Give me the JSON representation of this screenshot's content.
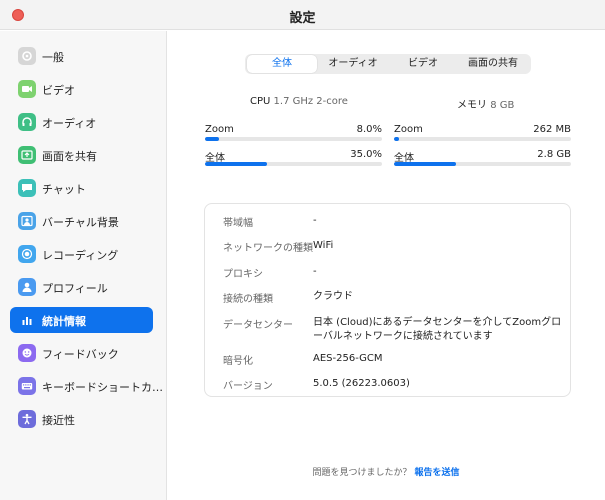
{
  "window": {
    "title": "設定"
  },
  "sidebar": {
    "items": [
      {
        "label": "一般",
        "icon": "gear-icon",
        "color": "#d6d6d6"
      },
      {
        "label": "ビデオ",
        "icon": "video-icon",
        "color": "#7ed26f"
      },
      {
        "label": "オーディオ",
        "icon": "headphones-icon",
        "color": "#3fbf86"
      },
      {
        "label": "画面を共有",
        "icon": "share-screen-icon",
        "color": "#3fbf74"
      },
      {
        "label": "チャット",
        "icon": "chat-icon",
        "color": "#3cc0b8"
      },
      {
        "label": "バーチャル背景",
        "icon": "virtual-background-icon",
        "color": "#4aa3e8"
      },
      {
        "label": "レコーディング",
        "icon": "recording-icon",
        "color": "#41a6ee"
      },
      {
        "label": "プロフィール",
        "icon": "profile-icon",
        "color": "#4a9af0"
      },
      {
        "label": "統計情報",
        "icon": "statistics-icon",
        "color": "#0e72ed",
        "active": true
      },
      {
        "label": "フィードバック",
        "icon": "feedback-icon",
        "color": "#8c6af0"
      },
      {
        "label": "キーボードショートカ…",
        "icon": "keyboard-icon",
        "color": "#7b73e8"
      },
      {
        "label": "接近性",
        "icon": "accessibility-icon",
        "color": "#6d6cdb"
      }
    ]
  },
  "tabs": [
    {
      "label": "全体",
      "active": true
    },
    {
      "label": "オーディオ"
    },
    {
      "label": "ビデオ"
    },
    {
      "label": "画面の共有"
    }
  ],
  "system": {
    "cpu_label": "CPU",
    "cpu_value": "1.7 GHz 2-core",
    "memory_label": "メモリ",
    "memory_value": "8 GB"
  },
  "metrics": {
    "cpu": [
      {
        "name": "Zoom",
        "value": "8.0%",
        "fill": 0.08
      },
      {
        "name": "全体",
        "value": "35.0%",
        "fill": 0.35
      }
    ],
    "memory": [
      {
        "name": "Zoom",
        "value": "262 MB",
        "fill": 0.03
      },
      {
        "name": "全体",
        "value": "2.8 GB",
        "fill": 0.35
      }
    ]
  },
  "info": [
    {
      "key": "帯域幅",
      "value": "-"
    },
    {
      "key": "ネットワークの種類",
      "value": "WiFi"
    },
    {
      "key": "プロキシ",
      "value": "-"
    },
    {
      "key": "接続の種類",
      "value": "クラウド"
    },
    {
      "key": "データセンター",
      "value": "日本 (Cloud)にあるデータセンターを介してZoomグローバルネットワークに接続されています"
    },
    {
      "key": "暗号化",
      "value": "AES-256-GCM"
    },
    {
      "key": "バージョン",
      "value": "5.0.5 (26223.0603)"
    }
  ],
  "footer": {
    "question": "問題を見つけましたか？",
    "link": "報告を送信"
  },
  "colors": {
    "accent": "#0e72ed",
    "close": "#ee5f57"
  }
}
